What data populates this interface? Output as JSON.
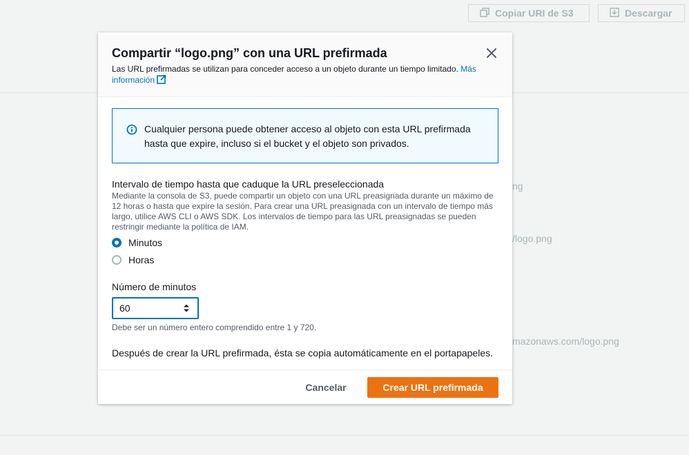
{
  "background": {
    "copy_button_label": "Copiar URI de S3",
    "download_button_label": "Descargar",
    "fragments": [
      "ng",
      "/logo.png",
      "mazonaws.com/logo.png"
    ]
  },
  "modal": {
    "title": "Compartir “logo.png” con una URL prefirmada",
    "description": "Las URL prefirmadas se utilizan para conceder acceso a un objeto durante un tiempo limitado.",
    "more_info_link": "Más información",
    "alert_text": "Cualquier persona puede obtener acceso al objeto con esta URL prefirmada hasta que expire, incluso si el bucket y el objeto son privados.",
    "interval_label": "Intervalo de tiempo hasta que caduque la URL preseleccionada",
    "interval_description": "Mediante la consola de S3, puede compartir un objeto con una URL preasignada durante un máximo de 12 horas o hasta que expire la sesión. Para crear una URL preasignada con un intervalo de tiempo más largo, utilice AWS CLI o AWS SDK. Los intervalos de tiempo para las URL preasignadas se pueden restringir mediante la política de IAM.",
    "radio_options": [
      {
        "label": "Minutos",
        "checked": true
      },
      {
        "label": "Horas",
        "checked": false
      }
    ],
    "minutes_label": "Número de minutos",
    "minutes_value": "60",
    "minutes_hint": "Debe ser un número entero comprendido entre 1 y 720.",
    "after_text": "Después de crear la URL prefirmada, ésta se copia automáticamente en el portapapeles.",
    "cancel_label": "Cancelar",
    "create_label": "Crear URL prefirmada"
  },
  "colors": {
    "primary": "#ec7211",
    "link": "#0073bb",
    "alert_bg": "#f1faff"
  }
}
